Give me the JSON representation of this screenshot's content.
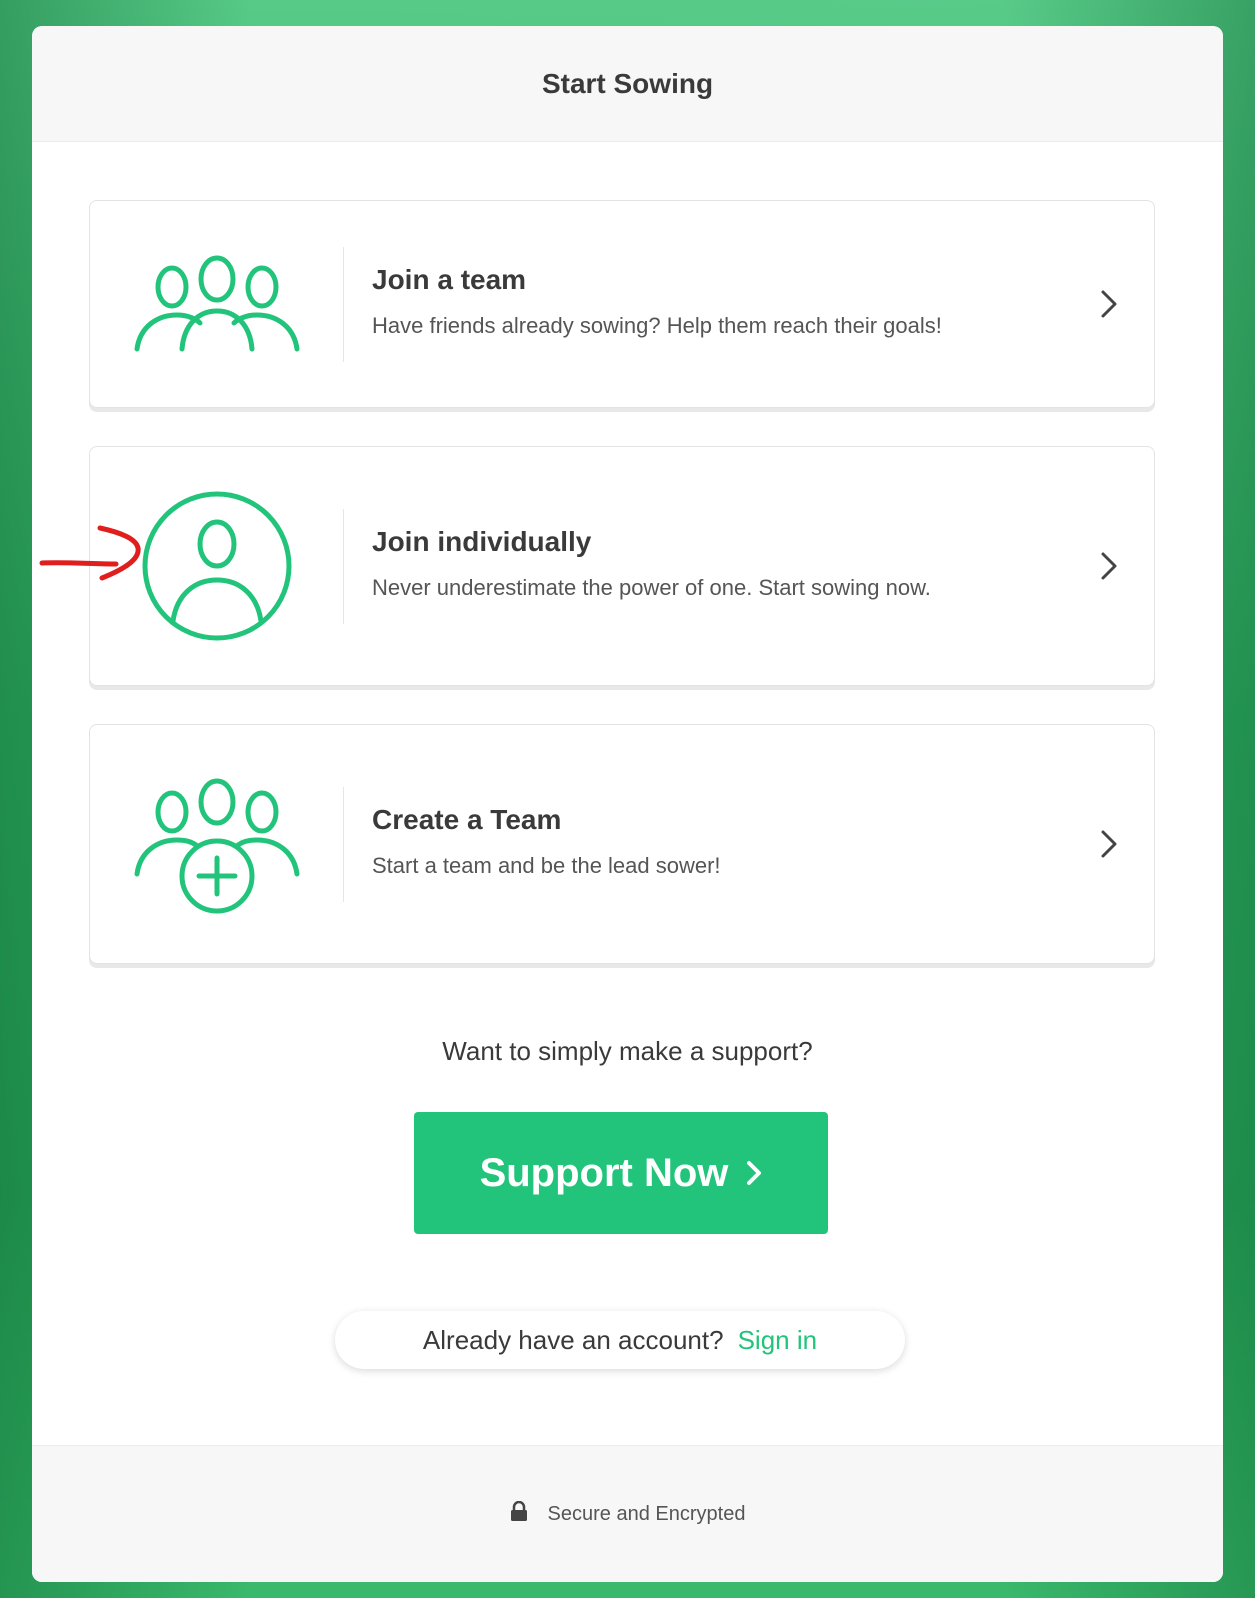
{
  "header": {
    "title": "Start Sowing"
  },
  "options": [
    {
      "title": "Join a team",
      "description": "Have friends already sowing? Help them reach their goals!",
      "icon": "group-icon"
    },
    {
      "title": "Join individually",
      "description": "Never underestimate the power of one. Start sowing now.",
      "icon": "person-circle-icon"
    },
    {
      "title": "Create a Team",
      "description": "Start a team and be the lead sower!",
      "icon": "group-add-icon"
    }
  ],
  "support": {
    "prompt": "Want to simply make a support?",
    "button_label": "Support Now"
  },
  "signin": {
    "prompt": "Already have an account?",
    "link_label": "Sign in"
  },
  "footer": {
    "text": "Secure and Encrypted",
    "icon": "lock-icon"
  },
  "colors": {
    "accent": "#21c47a",
    "annotation": "#e01e1e"
  }
}
